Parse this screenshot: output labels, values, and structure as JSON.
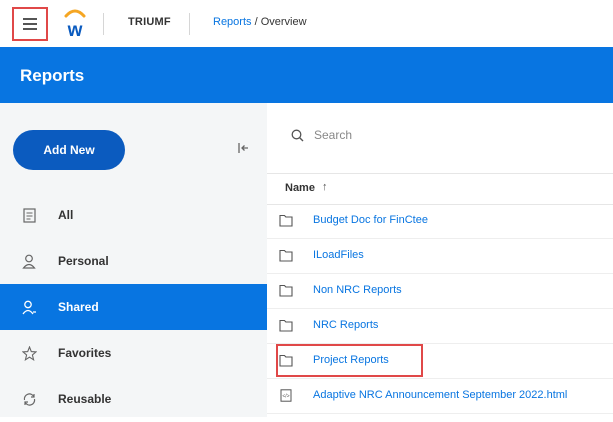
{
  "topbar": {
    "menu_icon": "hamburger-menu-icon",
    "logo": "workday-logo",
    "tenant": "TRIUMF",
    "breadcrumb": {
      "link": "Reports",
      "separator": "/",
      "current": "Overview"
    }
  },
  "header": {
    "title": "Reports"
  },
  "sidebar": {
    "add_new_label": "Add New",
    "collapse_icon": "collapse-sidebar-icon",
    "items": [
      {
        "label": "All",
        "icon": "document-icon",
        "active": false
      },
      {
        "label": "Personal",
        "icon": "person-icon",
        "active": false
      },
      {
        "label": "Shared",
        "icon": "shared-people-icon",
        "active": true
      },
      {
        "label": "Favorites",
        "icon": "star-icon",
        "active": false
      },
      {
        "label": "Reusable",
        "icon": "reuse-icon",
        "active": false
      }
    ]
  },
  "main": {
    "search": {
      "placeholder": "Search",
      "icon": "search-icon"
    },
    "columns": {
      "name": "Name",
      "sort": "↑"
    },
    "rows": [
      {
        "label": "Budget Doc for FinCtee",
        "icon": "folder-icon"
      },
      {
        "label": "ILoadFiles",
        "icon": "folder-icon"
      },
      {
        "label": "Non NRC Reports",
        "icon": "folder-icon"
      },
      {
        "label": "NRC Reports",
        "icon": "folder-icon"
      },
      {
        "label": "Project Reports",
        "icon": "folder-icon"
      },
      {
        "label": "Adaptive NRC Announcement September 2022.html",
        "icon": "html-file-icon"
      }
    ]
  },
  "colors": {
    "accent": "#0875e1",
    "button": "#0b5bbf",
    "highlight": "#e04848",
    "sidebar_bg": "#f4f6f7"
  }
}
